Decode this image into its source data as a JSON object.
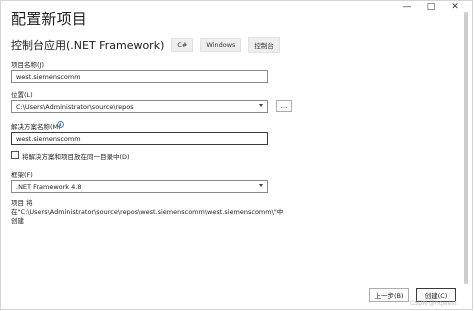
{
  "window": {
    "minimize_glyph": "—",
    "maximize_glyph": "□",
    "close_glyph": "✕"
  },
  "dialog": {
    "title": "配置新项目"
  },
  "template": {
    "name": "控制台应用(.NET Framework)",
    "tags": [
      "C#",
      "Windows",
      "控制台"
    ]
  },
  "form": {
    "project_name_label": "项目名称(J)",
    "project_name_value": "west.siemenscomm",
    "location_label": "位置(L)",
    "location_value": "C:\\Users\\Administrator\\source\\repos",
    "browse_label": "...",
    "solution_name_label": "解决方案名称(M)",
    "solution_name_value": "west.siemenscomm",
    "same_dir_label": "将解决方案和项目放在同一目录中(D)",
    "same_dir_checked": false,
    "framework_label": "框架(F)",
    "framework_value": ".NET Framework 4.8",
    "summary_text": "项目 将在\"C:\\Users\\Administrator\\source\\repos\\west.siemenscomm\\west.siemenscomm\\\"中创建"
  },
  "footer": {
    "prev_label": "上一步(B)",
    "create_label": "创建(C)"
  },
  "watermark": "CSDN @hqwest"
}
